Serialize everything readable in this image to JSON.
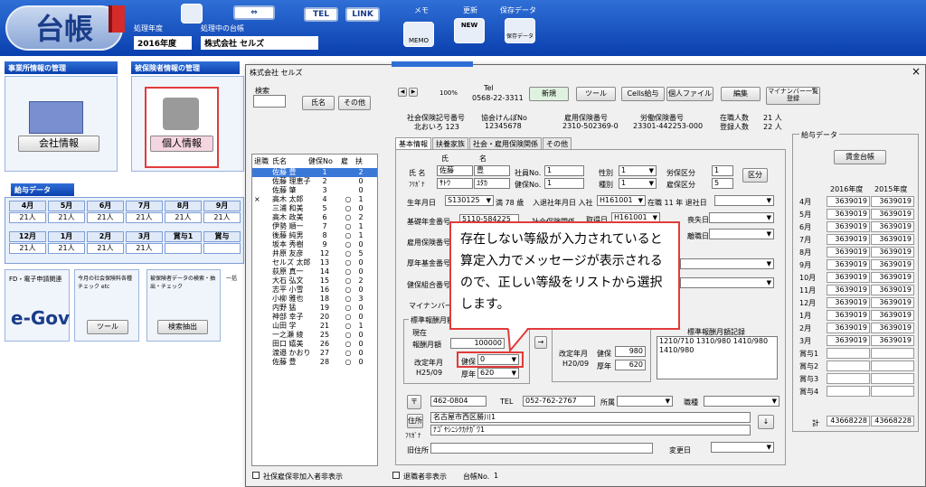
{
  "header": {
    "logo_text": "台帳",
    "year_label": "処理年度",
    "year_value": "2016年度",
    "ledger_label": "処理中の台帳",
    "ledger_value": "株式会社 セルズ",
    "tel_btn": "TEL",
    "link_btn": "LINK",
    "memo_label": "メモ",
    "memo_icon_text": "MEMO",
    "update_label": "更新",
    "update_icon_text": "NEW",
    "save_label": "保存データ",
    "save_icon_text": "保存データ"
  },
  "left_panel": {
    "office_title": "事業所情報の管理",
    "office_btn": "会社情報",
    "insured_title": "被保険者情報の管理",
    "insured_btn": "個人情報",
    "payroll_title": "給与データ",
    "months_row1": [
      "4月",
      "5月",
      "6月",
      "7月",
      "8月",
      "9月"
    ],
    "counts_row1": [
      "21人",
      "21人",
      "21人",
      "21人",
      "21人",
      "21人"
    ],
    "months_row2": [
      "12月",
      "1月",
      "2月",
      "3月",
      "賞与1",
      "賞与"
    ],
    "counts_row2": [
      "21人",
      "21人",
      "21人",
      "21人",
      "",
      ""
    ],
    "egov_caption": "FD・電子申請関連",
    "egov_logo": "e-Gov",
    "tool_caption": "今月の社会保険料各種チェック etc",
    "tool_btn": "ツール",
    "search_caption": "被保険者データの検索・抽出・チェック",
    "search_btn": "検索抽出",
    "bulk_caption": "一括"
  },
  "dialog": {
    "title": "株式会社 セルズ",
    "close": "×",
    "search_label": "検索",
    "name_btn": "氏名",
    "other_btn": "その他",
    "list_headers": [
      "退職",
      "氏名",
      "健保No",
      "雇",
      "扶"
    ],
    "employees": [
      {
        "retired": "",
        "name": "佐藤 豊",
        "no": "1",
        "emp": "",
        "dep": "2",
        "selected": true
      },
      {
        "retired": "",
        "name": "佐藤 理恵子",
        "no": "2",
        "emp": "",
        "dep": "0"
      },
      {
        "retired": "",
        "name": "佐藤 肇",
        "no": "3",
        "emp": "",
        "dep": "0"
      },
      {
        "retired": "×",
        "name": "高木 太郎",
        "no": "4",
        "emp": "○",
        "dep": "1"
      },
      {
        "retired": "",
        "name": "三浦 和美",
        "no": "5",
        "emp": "○",
        "dep": "0"
      },
      {
        "retired": "",
        "name": "高木 政美",
        "no": "6",
        "emp": "○",
        "dep": "2"
      },
      {
        "retired": "",
        "name": "伊勢 順一",
        "no": "7",
        "emp": "○",
        "dep": "1"
      },
      {
        "retired": "",
        "name": "後藤 純男",
        "no": "8",
        "emp": "○",
        "dep": "1"
      },
      {
        "retired": "",
        "name": "坂本 秀樹",
        "no": "9",
        "emp": "○",
        "dep": "0"
      },
      {
        "retired": "",
        "name": "井原 友彦",
        "no": "12",
        "emp": "○",
        "dep": "5"
      },
      {
        "retired": "",
        "name": "セルズ 太郎",
        "no": "13",
        "emp": "○",
        "dep": "0"
      },
      {
        "retired": "",
        "name": "荻原 真一",
        "no": "14",
        "emp": "○",
        "dep": "0"
      },
      {
        "retired": "",
        "name": "大石 弘文",
        "no": "15",
        "emp": "○",
        "dep": "2"
      },
      {
        "retired": "",
        "name": "志平 小雪",
        "no": "16",
        "emp": "○",
        "dep": "0"
      },
      {
        "retired": "",
        "name": "小柳 雅也",
        "no": "18",
        "emp": "○",
        "dep": "3"
      },
      {
        "retired": "",
        "name": "内野 猛",
        "no": "19",
        "emp": "○",
        "dep": "0"
      },
      {
        "retired": "",
        "name": "神部 幸子",
        "no": "20",
        "emp": "○",
        "dep": "0"
      },
      {
        "retired": "",
        "name": "山田 学",
        "no": "21",
        "emp": "○",
        "dep": "1"
      },
      {
        "retired": "",
        "name": "一之瀬 綾",
        "no": "25",
        "emp": "○",
        "dep": "0"
      },
      {
        "retired": "",
        "name": "田口 嬉美",
        "no": "26",
        "emp": "○",
        "dep": "0"
      },
      {
        "retired": "",
        "name": "渡邉 かおり",
        "no": "27",
        "emp": "○",
        "dep": "0"
      },
      {
        "retired": "",
        "name": "佐藤 豊",
        "no": "28",
        "emp": "○",
        "dep": "0"
      }
    ],
    "hide_employment_label": "社保雇保非加入者非表示",
    "hide_retired_label": "退職者非表示",
    "ledger_no_label": "台帳No.",
    "ledger_no_value": "1",
    "nav_zoom": "100%",
    "tel_label": "Tel",
    "tel_value": "0568-22-3311",
    "toolbar": [
      "新規",
      "ツール",
      "Cells給与",
      "個人ファイル",
      "編集",
      "マイナンバー一覧登録"
    ],
    "social_no_label": "社会保険記号番号",
    "social_no_value": "北おいろ 123",
    "kyokai_label": "協会けんぽNo",
    "kyokai_value": "12345678",
    "koyo_label": "雇用保険番号",
    "koyo_value": "2310-502369-0",
    "rodo_label": "労働保険番号",
    "rodo_value": "23301-442253-000",
    "zaishoku_label": "在職人数",
    "zaishoku_value": "21 人",
    "toroku_label": "登録人数",
    "toroku_value": "22 人",
    "tabs": [
      "基本情報",
      "扶養家族",
      "社会・雇用保険関係",
      "その他"
    ],
    "name_label": "氏 名",
    "sei_label": "氏",
    "mei_label": "名",
    "sei": "佐藤",
    "mei": "豊",
    "furigana_label": "ﾌﾘｶﾞﾅ",
    "sei_kana": "ｻﾄｳ",
    "mei_kana": "ﾕﾀｶ",
    "shain_label": "社員No.",
    "shain_value": "1",
    "kenpo_label": "健保No.",
    "kenpo_value": "1",
    "seibetsu_label": "性別",
    "seibetsu_value": "1",
    "shubetsu_label": "種別",
    "shubetsu_value": "1",
    "rouho_label": "労保区分",
    "rouho_value": "1",
    "koho_label": "雇保区分",
    "koho_value": "5",
    "kubun_btn": "区分",
    "birth_label": "生年月日",
    "birth_value": "S130125",
    "age_text": "満 78 歳",
    "hire_label": "入退社年月日 入社",
    "hire_value": "H161001",
    "tenure_text": "在職 11 年 退社日",
    "kijun_label": "基礎年金番号",
    "kijun_value": "5110-584225",
    "shakai_label": "社会保険関係",
    "shutoku_label": "取得日",
    "shutoku_value": "H161001",
    "soshitsu_label": "喪失日",
    "koyo_no_label": "雇用保険番号",
    "rishoku_label": "離職日",
    "kosei_label": "厚年基金番号",
    "kenkou_label": "健保組合番号",
    "mynumber_label": "マイナンバー",
    "hyojun_title": "標準報酬月額",
    "genzai_label": "現在",
    "hoshu_label": "報酬月額",
    "hoshu_value": "100000",
    "kaitei_label": "改定年月",
    "kaitei_value": "H25/09",
    "kenpo_grade_label": "健保",
    "kenpo_grade_value": "0",
    "kounen_label": "厚年",
    "kounen_value": "620",
    "kaitei2_label": "改定年月",
    "kaitei2_value": "H20/09",
    "kenpo2_label": "健保",
    "kenpo2_value": "980",
    "kounen2_label": "厚年",
    "kounen2_value": "620",
    "kiroku_title": "標準報酬月額記録",
    "kiroku_value": "1210/710 1310/980 1410/980 1410/980",
    "zip_btn": "〒",
    "zip_value": "462-0804",
    "tel2_label": "TEL",
    "tel2_value": "052-762-2767",
    "shozoku_label": "所属",
    "shokushu_label": "職種",
    "address_btn": "住所",
    "address_value": "名古屋市西区勝川1",
    "address_kana_label": "ﾌﾘｶﾞﾅ",
    "address_kana": "ﾅｺﾞﾔｼﾆｼｸｶﾁｶﾞﾜ1",
    "old_address_label": "旧住所",
    "henko_label": "変更日"
  },
  "kyuyo": {
    "title": "給与データ",
    "ledger_btn": "賃金台帳",
    "year1": "2016年度",
    "year2": "2015年度",
    "rows": [
      {
        "label": "4月",
        "v1": "3639019",
        "v2": "3639019"
      },
      {
        "label": "5月",
        "v1": "3639019",
        "v2": "3639019"
      },
      {
        "label": "6月",
        "v1": "3639019",
        "v2": "3639019"
      },
      {
        "label": "7月",
        "v1": "3639019",
        "v2": "3639019"
      },
      {
        "label": "8月",
        "v1": "3639019",
        "v2": "3639019"
      },
      {
        "label": "9月",
        "v1": "3639019",
        "v2": "3639019"
      },
      {
        "label": "10月",
        "v1": "3639019",
        "v2": "3639019"
      },
      {
        "label": "11月",
        "v1": "3639019",
        "v2": "3639019"
      },
      {
        "label": "12月",
        "v1": "3639019",
        "v2": "3639019"
      },
      {
        "label": "1月",
        "v1": "3639019",
        "v2": "3639019"
      },
      {
        "label": "2月",
        "v1": "3639019",
        "v2": "3639019"
      },
      {
        "label": "3月",
        "v1": "3639019",
        "v2": "3639019"
      },
      {
        "label": "賞与1",
        "v1": "",
        "v2": ""
      },
      {
        "label": "賞与2",
        "v1": "",
        "v2": ""
      },
      {
        "label": "賞与3",
        "v1": "",
        "v2": ""
      },
      {
        "label": "賞与4",
        "v1": "",
        "v2": ""
      }
    ],
    "total_label": "計",
    "total1": "43668228",
    "total2": "43668228"
  },
  "callout": {
    "text": "存在しない等級が入力されていると算定入力でメッセージが表示されるので、正しい等級をリストから選択します。"
  }
}
